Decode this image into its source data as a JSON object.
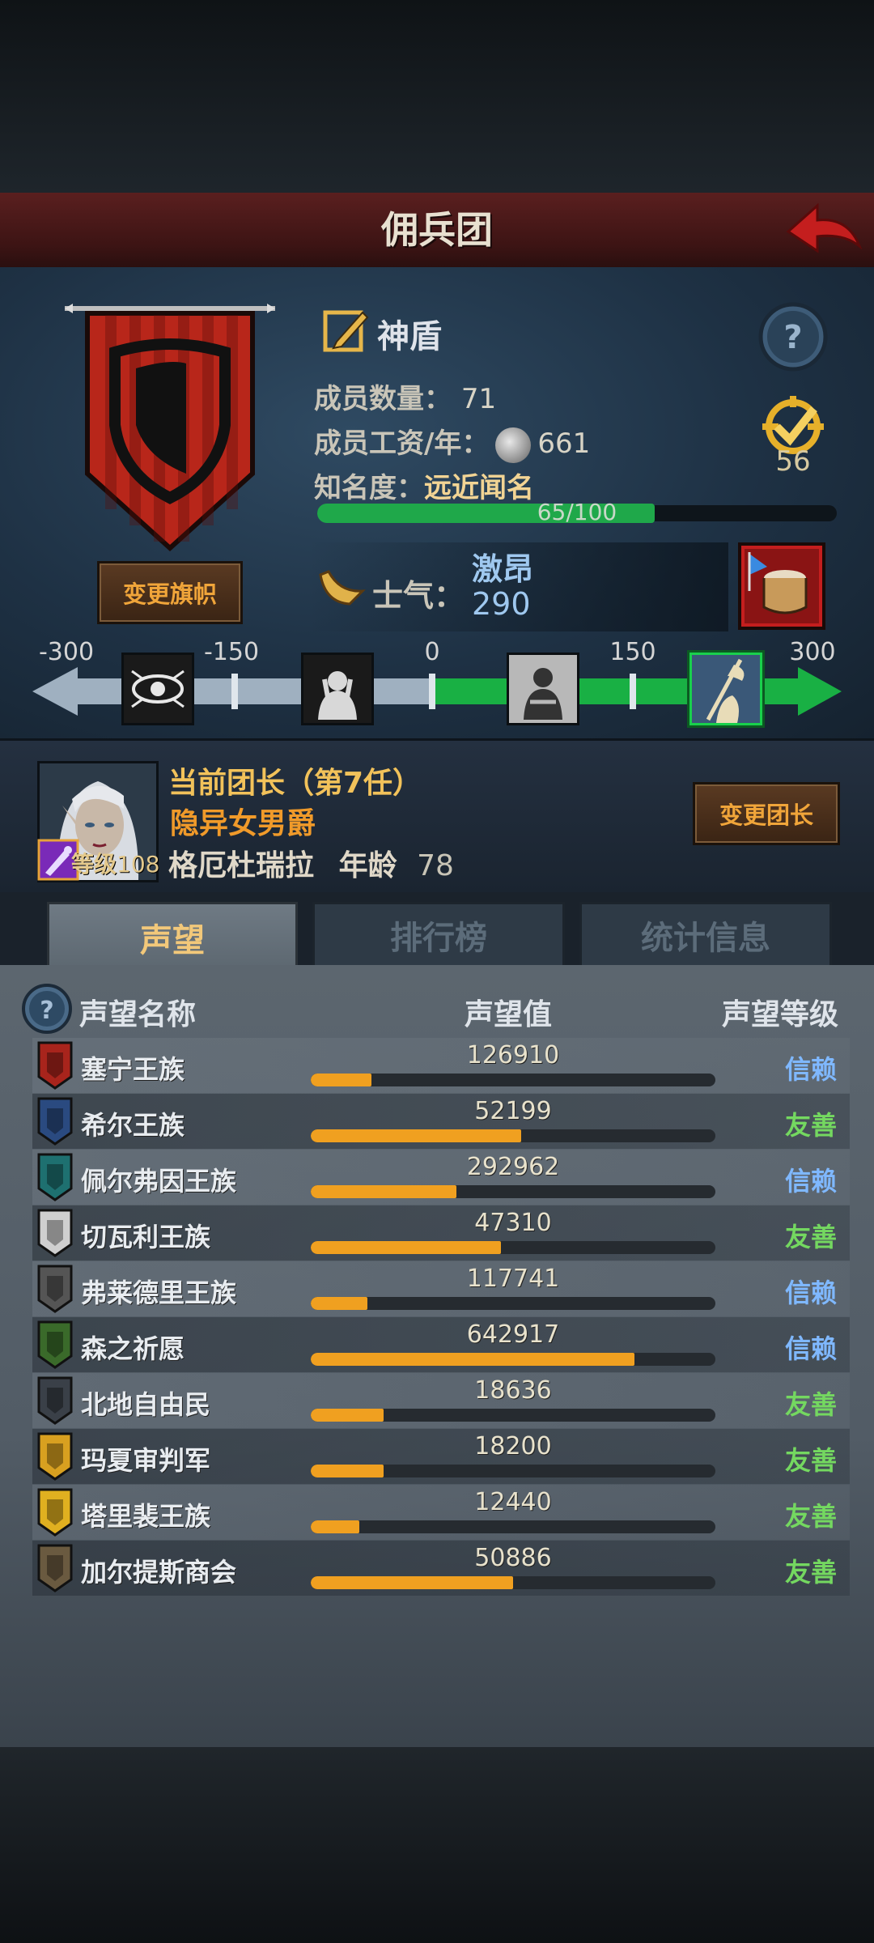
{
  "header": {
    "title": "佣兵团"
  },
  "company": {
    "name": "神盾",
    "members_label": "成员数量：",
    "members": "71",
    "wage_label": "成员工资/年：",
    "wage": "661",
    "fame_label": "知名度：",
    "fame_value": "远近闻名",
    "fame_progress_text": "65/100",
    "fame_progress": 0.65,
    "badge_count": "56",
    "change_flag_label": "变更旗帜",
    "morale_label": "士气：",
    "morale_state": "激昂",
    "morale_value": "290",
    "morale_scale": [
      "-300",
      "-150",
      "0",
      "150",
      "300"
    ]
  },
  "leader": {
    "title": "当前团长（第7任）",
    "rank": "隐异女男爵",
    "name": "格厄杜瑞拉",
    "age_label": "年龄",
    "age": "78",
    "level_label": "等级",
    "level": "108",
    "change_leader_label": "变更团长"
  },
  "tabs": [
    {
      "label": "声望",
      "active": true
    },
    {
      "label": "排行榜",
      "active": false
    },
    {
      "label": "统计信息",
      "active": false
    }
  ],
  "reputation": {
    "col_name": "声望名称",
    "col_value": "声望值",
    "col_level": "声望等级",
    "rows": [
      {
        "name": "塞宁王族",
        "value": "126910",
        "fill": 0.15,
        "level": "信赖",
        "type": "trust",
        "icon_color": "#a8241c"
      },
      {
        "name": "希尔王族",
        "value": "52199",
        "fill": 0.52,
        "level": "友善",
        "type": "friend",
        "icon_color": "#2a4a80"
      },
      {
        "name": "佩尔弗因王族",
        "value": "292962",
        "fill": 0.36,
        "level": "信赖",
        "type": "trust",
        "icon_color": "#1e7070"
      },
      {
        "name": "切瓦利王族",
        "value": "47310",
        "fill": 0.47,
        "level": "友善",
        "type": "friend",
        "icon_color": "#cfcfcf"
      },
      {
        "name": "弗莱德里王族",
        "value": "117741",
        "fill": 0.14,
        "level": "信赖",
        "type": "trust",
        "icon_color": "#555555"
      },
      {
        "name": "森之祈愿",
        "value": "642917",
        "fill": 0.8,
        "level": "信赖",
        "type": "trust",
        "icon_color": "#3a6a2a"
      },
      {
        "name": "北地自由民",
        "value": "18636",
        "fill": 0.18,
        "level": "友善",
        "type": "friend",
        "icon_color": "#3a4048"
      },
      {
        "name": "玛夏审判军",
        "value": "18200",
        "fill": 0.18,
        "level": "友善",
        "type": "friend",
        "icon_color": "#d8a020"
      },
      {
        "name": "塔里裴王族",
        "value": "12440",
        "fill": 0.12,
        "level": "友善",
        "type": "friend",
        "icon_color": "#e0b020"
      },
      {
        "name": "加尔提斯商会",
        "value": "50886",
        "fill": 0.5,
        "level": "友善",
        "type": "friend",
        "icon_color": "#6a5a40"
      }
    ]
  }
}
